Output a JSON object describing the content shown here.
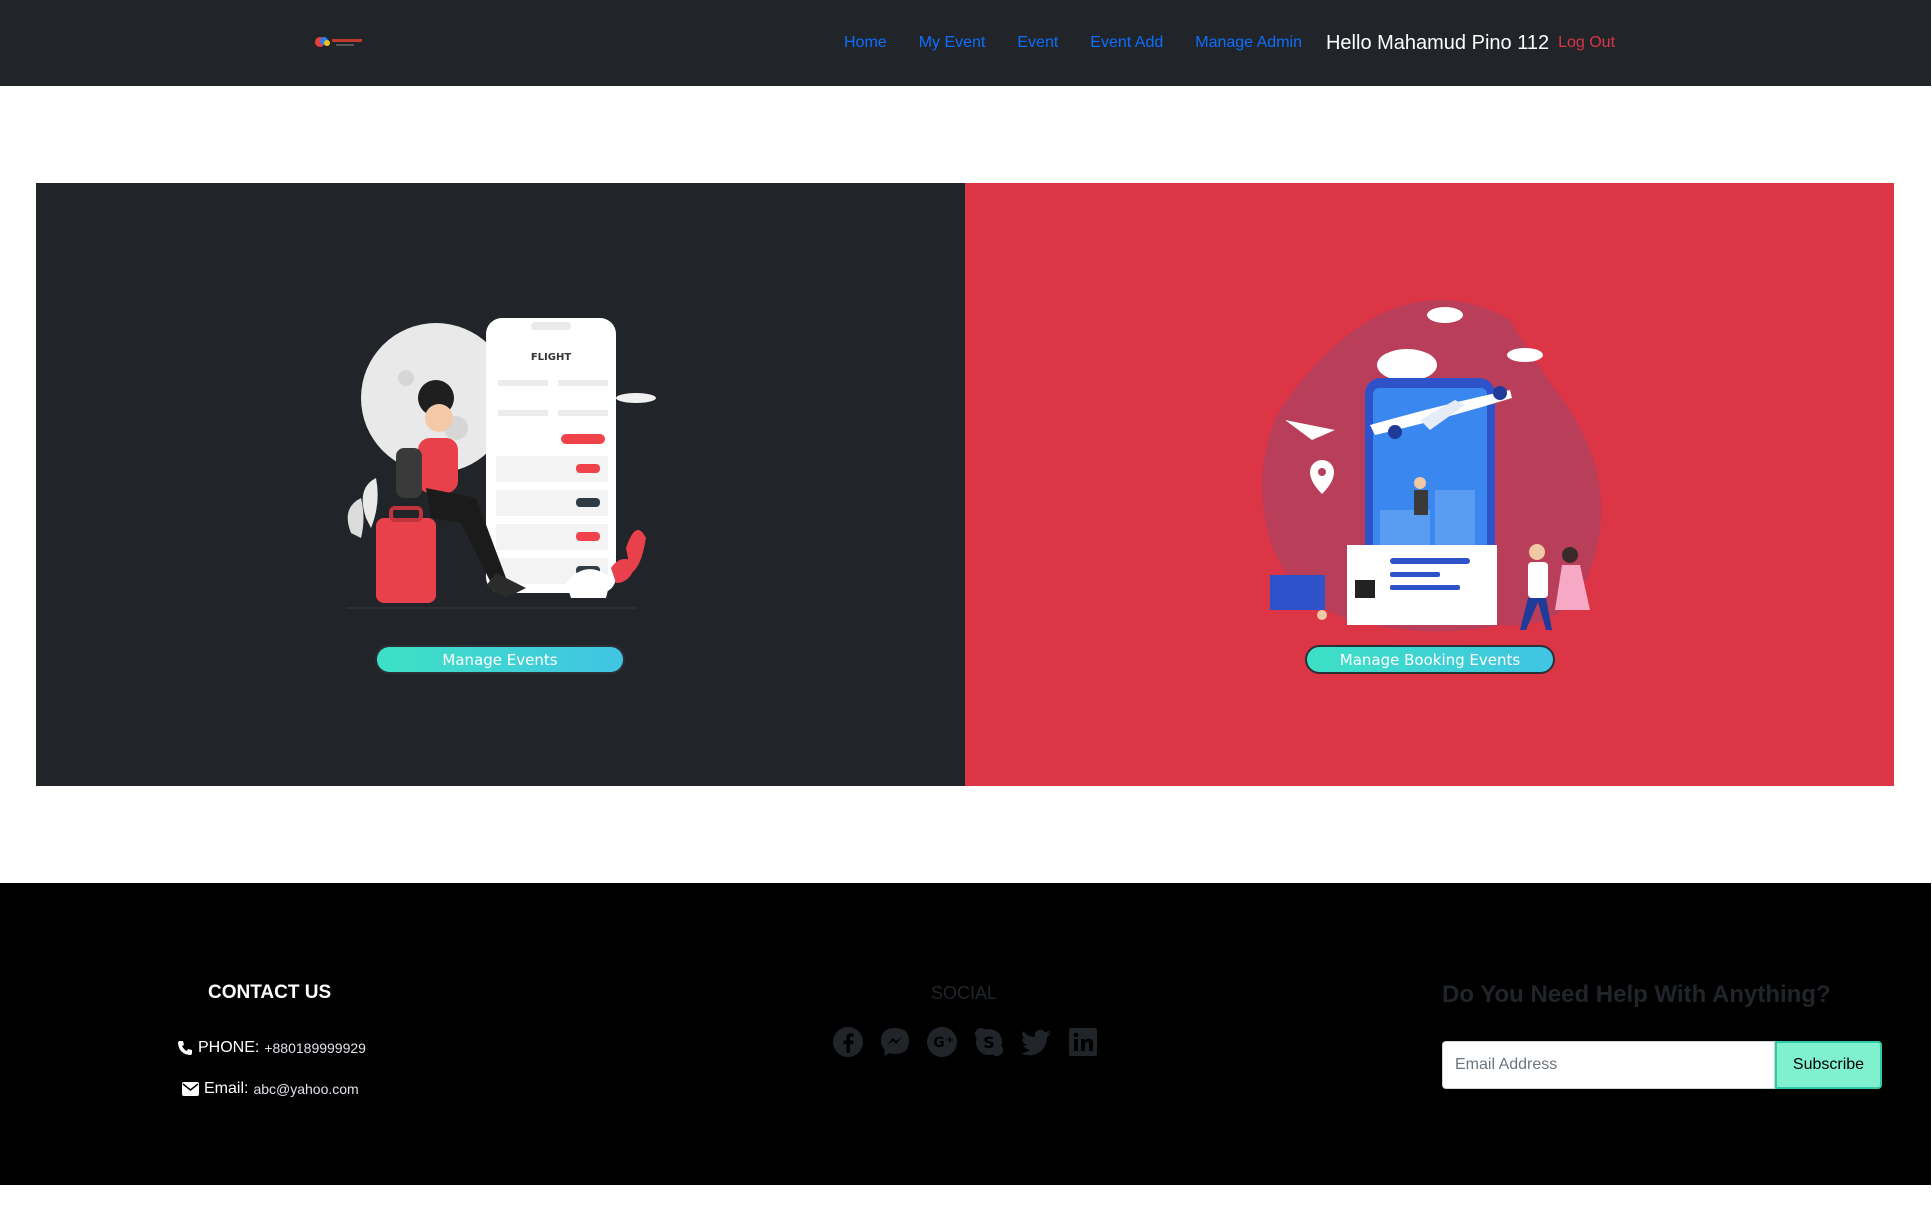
{
  "nav": {
    "links": [
      "Home",
      "My Event",
      "Event",
      "Event Add",
      "Manage Admin"
    ],
    "greeting": "Hello Mahamud Pino 112",
    "logout": "Log Out"
  },
  "panels": {
    "left": {
      "button": "Manage Events",
      "illustration": "flight-booking-illustration"
    },
    "right": {
      "button": "Manage Booking Events",
      "illustration": "travel-phone-illustration"
    }
  },
  "footer": {
    "contact_title": "CONTACT US",
    "phone_label": "PHONE:",
    "phone_value": "+880189999929",
    "email_label": "Email:",
    "email_value": "abc@yahoo.com",
    "social_title": "SOCIAL",
    "social_icons": [
      "facebook-icon",
      "messenger-icon",
      "google-plus-icon",
      "skype-icon",
      "twitter-icon",
      "linkedin-icon"
    ],
    "help_title": "Do You Need Help With Anything?",
    "email_placeholder": "Email Address",
    "subscribe": "Subscribe"
  },
  "colors": {
    "navbar_bg": "#212529",
    "link": "#0d6efd",
    "logout": "#dc3545",
    "panel_dark": "#212529",
    "panel_red": "#dc3545",
    "subscribe_bg": "#7ff1cf"
  }
}
